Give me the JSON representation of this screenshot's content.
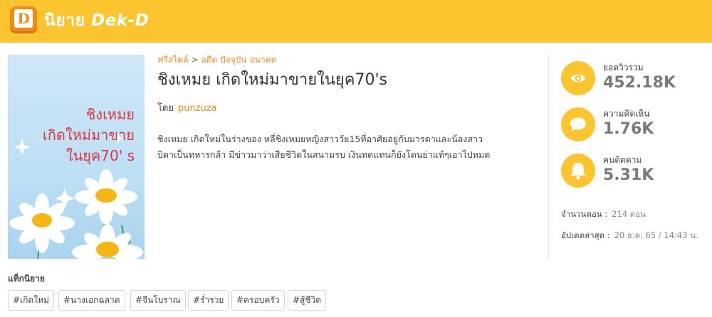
{
  "header": {
    "site_name_thai": "นิยาย",
    "site_name_brand": "Dek-D",
    "logo_letter": "D"
  },
  "cover": {
    "title_lines": [
      "ชิงเหมย",
      "เกิดใหม่มาขาย",
      "ในยุค70' s"
    ],
    "background_color": "#bcdff4",
    "title_color": "#d9363e"
  },
  "novel": {
    "breadcrumb": {
      "genre": "ฟรีสไตล์",
      "separator": ">",
      "subgenre": "อดีต ปัจจุบัน อนาคต"
    },
    "title": "ชิงเหมย เกิดใหม่มาขายในยุค70's",
    "by_label": "โดย",
    "author": "punzuza",
    "synopsis_lines": [
      "ชิงเหมย เกิดใหม่ในร่างของ หลี่ชิงเหมยหญิงสาววัย15ที่อาศัยอยู่กับมารดาและน้องสาว",
      "บิดาเป็นทหารกล้า มีข่าวมาว่าเสียชีวิตในสนามรบ เงินทดแทนก็ยังโดนย่าแท้ๆเอาไปหมด"
    ]
  },
  "stats": [
    {
      "icon": "eye-icon",
      "label": "ยอดวิวรวม",
      "value": "452.18K"
    },
    {
      "icon": "comment-icon",
      "label": "ความคิดเห็น",
      "value": "1.76K"
    },
    {
      "icon": "bell-icon",
      "label": "คนติดตาม",
      "value": "5.31K"
    }
  ],
  "meta": {
    "episodes_label": "จำนวนตอน :",
    "episodes_value": "214 ตอน",
    "updated_label": "อัปเดตล่าสุด :",
    "updated_value": "20 ธ.ค. 65 / 14:43 น."
  },
  "tags": {
    "label": "แท็กนิยาย",
    "items": [
      "#เกิดใหม่",
      "#นางเอกฉลาด",
      "#จีนโบราณ",
      "#ร่ำรวย",
      "#ครอบครัว",
      "#สู้ชีวิต"
    ]
  },
  "colors": {
    "header_bg": "#fcc42e",
    "accent_orange": "#e98b1e",
    "stat_circle": "#fcc42e",
    "stat_value": "#7a7a7a"
  }
}
